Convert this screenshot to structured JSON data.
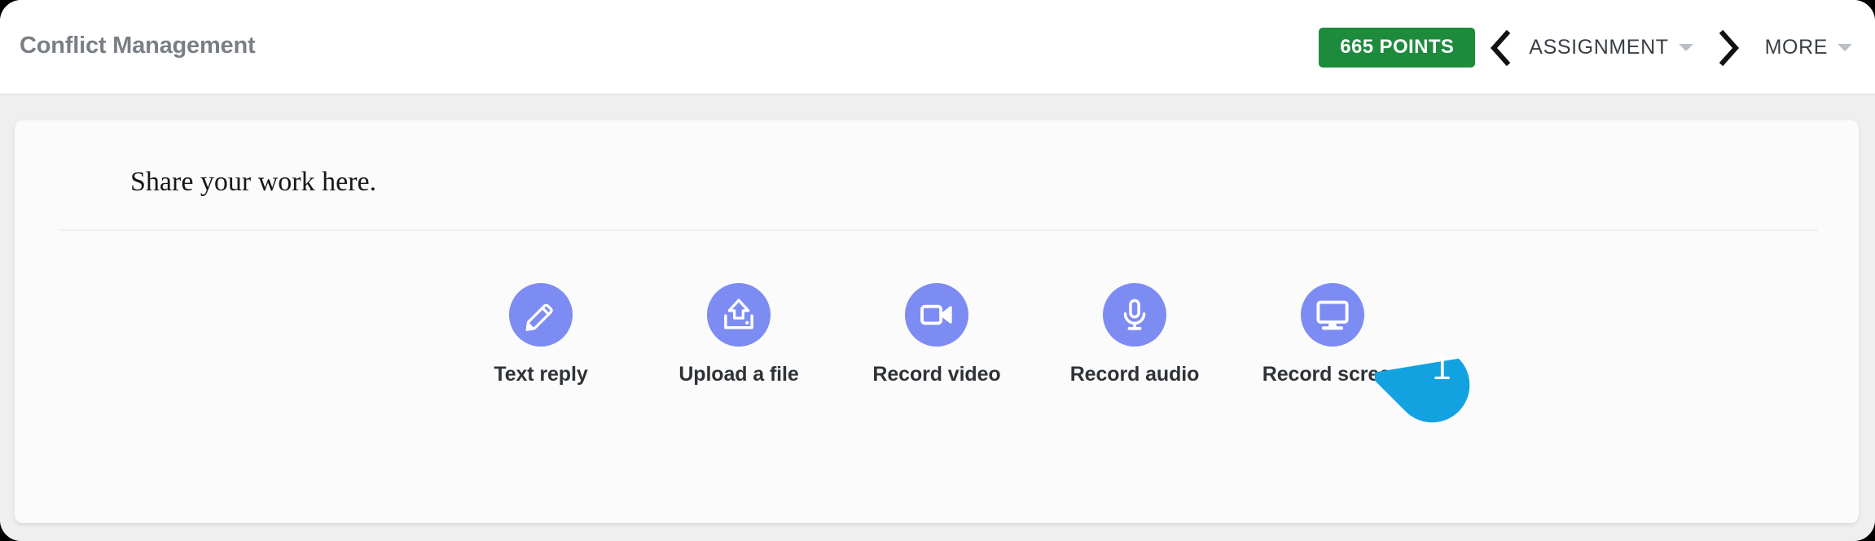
{
  "header": {
    "title": "Conflict Management",
    "points_label": "665 POINTS",
    "prev_icon": "chevron-left-icon",
    "next_icon": "chevron-right-icon",
    "assignment_menu": "ASSIGNMENT",
    "more_menu": "MORE",
    "points_color": "#1d8a3c"
  },
  "card": {
    "heading": "Share your work here.",
    "background": "#fbfbfb"
  },
  "options": {
    "accent_color": "#7d8cf3",
    "items": [
      {
        "label": "Text reply",
        "icon": "pencil-icon"
      },
      {
        "label": "Upload a file",
        "icon": "upload-icon"
      },
      {
        "label": "Record video",
        "icon": "video-camera-icon"
      },
      {
        "label": "Record audio",
        "icon": "microphone-icon"
      },
      {
        "label": "Record screen",
        "icon": "monitor-icon"
      }
    ]
  },
  "step_marker": {
    "number": "1",
    "color": "#12a2e0"
  }
}
